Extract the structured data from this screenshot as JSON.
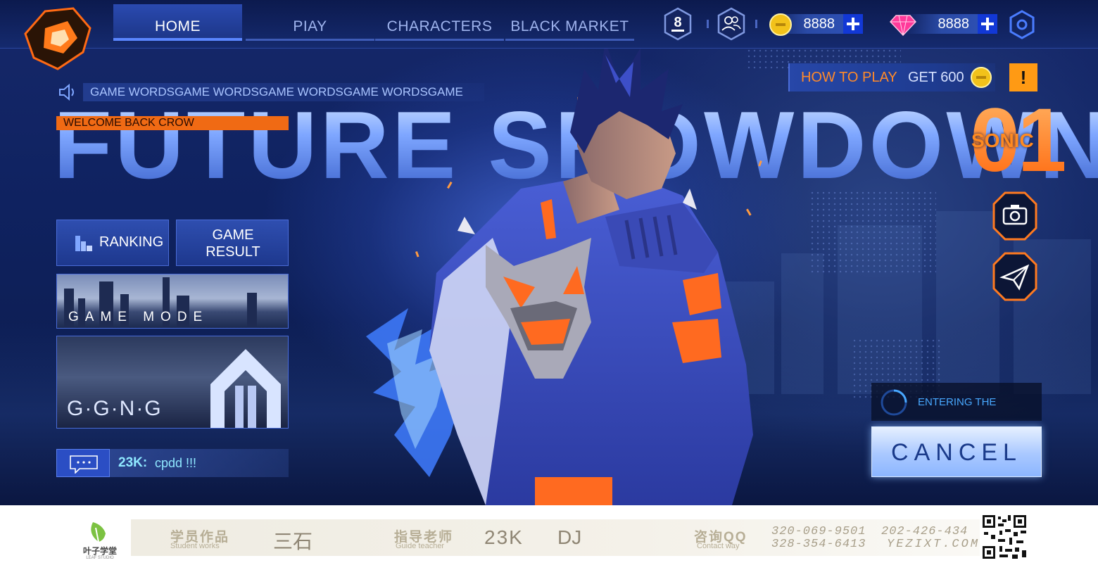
{
  "nav": {
    "tabs": [
      {
        "label": "HOME",
        "active": true
      },
      {
        "label": "PIAY",
        "active": false
      },
      {
        "label": "CHARACTERS",
        "active": false
      },
      {
        "label": "BLACK MARKET",
        "active": false
      }
    ]
  },
  "header": {
    "level": "8",
    "coins": "8888",
    "gems": "8888"
  },
  "marquee": {
    "text": "GAME WORDSGAME WORDSGAME WORDSGAME WORDSGAME"
  },
  "hero": {
    "title": "FUTURE SHOWDOWN",
    "welcome": "WELCOME BACK CROW"
  },
  "menu": {
    "ranking": "RANKING",
    "game_result": "GAME RESULT",
    "game_mode": "GAME MODE",
    "gang": "G·G·N·G"
  },
  "chat": {
    "user": "23K:",
    "message": "cpdd !!!"
  },
  "howto": {
    "label": "HOW TO PLAY",
    "reward": "GET  600",
    "alert": "!"
  },
  "rank": {
    "number": "01",
    "name": "SONIC"
  },
  "matchmaking": {
    "status": "ENTERING THE NATCH...",
    "cancel": "CANCEL"
  },
  "footer": {
    "brand": "叶子学堂",
    "brand_sub": "LEAF STUDIO",
    "student_label": "学员作品",
    "student_sub": "Student works",
    "student_name": "三石",
    "teacher_label": "指导老师",
    "teacher_sub": "Guide teacher",
    "teacher_1": "23K",
    "teacher_2": "DJ",
    "contact_label": "咨询QQ",
    "contact_sub": "Contact way",
    "qq_1": "320-069-9501",
    "qq_2": "202-426-434",
    "qq_3": "328-354-6413",
    "website": "YEZIXT.COM"
  },
  "colors": {
    "accent_orange": "#f06a14",
    "nav_blue": "#2a4ab0",
    "cancel_blue": "#a9c8ff"
  }
}
